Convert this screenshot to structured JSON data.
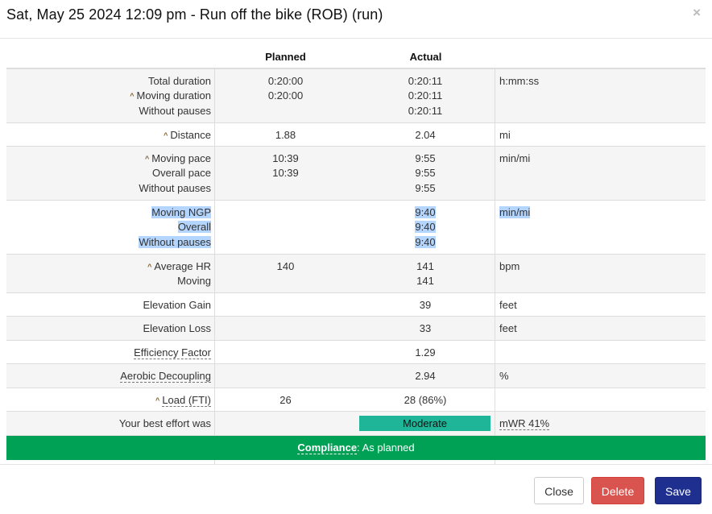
{
  "modal": {
    "title": "Sat, May 25 2024 12:09 pm - Run off the bike (ROB) (run)",
    "close_glyph": "×"
  },
  "table": {
    "headers": {
      "label": "",
      "planned": "Planned",
      "actual": "Actual",
      "unit": ""
    },
    "duration": {
      "labels": [
        "Total duration",
        "Moving duration",
        "Without pauses"
      ],
      "planned": [
        "0:20:00",
        "0:20:00",
        ""
      ],
      "actual": [
        "0:20:11",
        "0:20:11",
        "0:20:11"
      ],
      "unit": "h:mm:ss"
    },
    "distance": {
      "label": "Distance",
      "planned": "1.88",
      "actual": "2.04",
      "unit": "mi"
    },
    "pace": {
      "labels": [
        "Moving pace",
        "Overall pace",
        "Without pauses"
      ],
      "planned": [
        "10:39",
        "10:39",
        ""
      ],
      "actual": [
        "9:55",
        "9:55",
        "9:55"
      ],
      "unit": "min/mi"
    },
    "ngp": {
      "labels": [
        "Moving NGP",
        "Overall",
        "Without pauses"
      ],
      "actual": [
        "9:40",
        "9:40",
        "9:40"
      ],
      "unit": "min/mi"
    },
    "hr": {
      "labels": [
        "Average HR",
        "Moving"
      ],
      "planned": [
        "140",
        ""
      ],
      "actual": [
        "141",
        "141"
      ],
      "unit": "bpm"
    },
    "elev_gain": {
      "label": "Elevation Gain",
      "actual": "39",
      "unit": "feet"
    },
    "elev_loss": {
      "label": "Elevation Loss",
      "actual": "33",
      "unit": "feet"
    },
    "ef": {
      "label": "Efficiency Factor",
      "actual": "1.29",
      "unit": ""
    },
    "decoupling": {
      "label": "Aerobic Decoupling",
      "actual": "2.94",
      "unit": "%"
    },
    "load": {
      "label": "Load (FTI)",
      "planned": "26",
      "actual": "28 (86%)",
      "unit": ""
    },
    "effort": {
      "label": "Your best effort was",
      "value": "Moderate",
      "unit": "mWR 41%",
      "color": "#1fb598"
    }
  },
  "compliance": {
    "label": "Compliance",
    "sep": ":",
    "value": "As planned",
    "color": "#00a055"
  },
  "footer": {
    "close": "Close",
    "delete": "Delete",
    "save": "Save"
  },
  "colors": {
    "delete": "#d9534f",
    "save": "#1f2f8f",
    "caret": "#7a5a2a",
    "highlight": "#b4d5fd"
  }
}
